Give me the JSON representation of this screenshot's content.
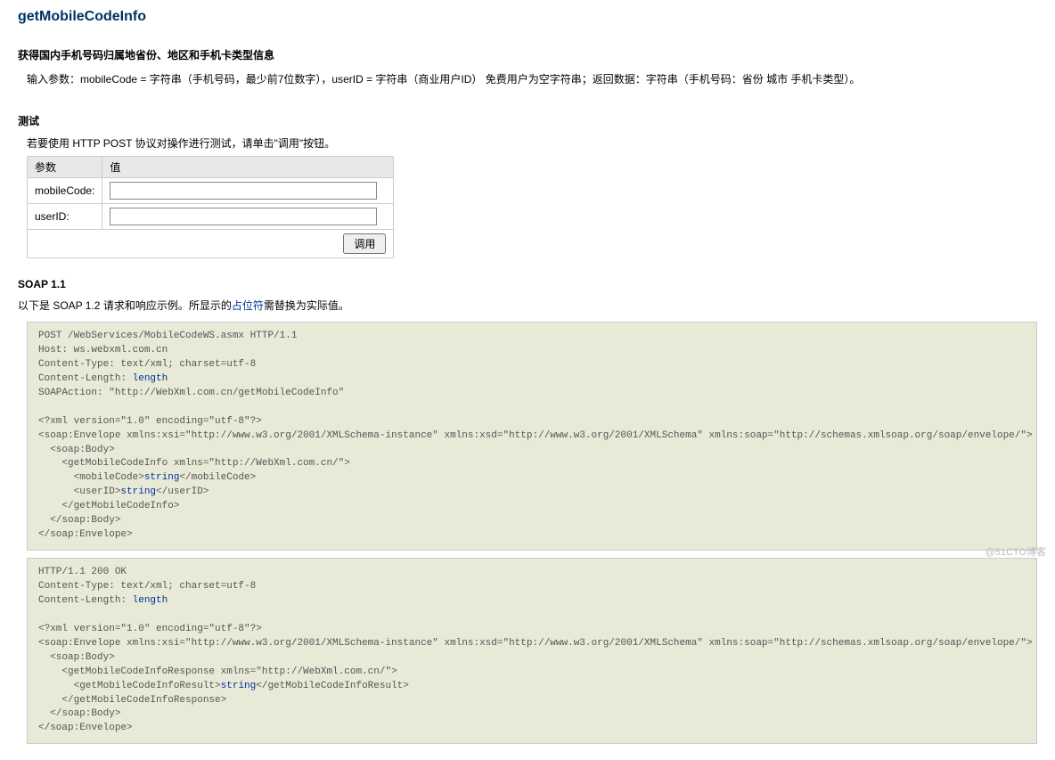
{
  "page": {
    "title": "getMobileCodeInfo",
    "subtitle": "获得国内手机号码归属地省份、地区和手机卡类型信息",
    "param_desc": "输入参数：mobileCode = 字符串（手机号码，最少前7位数字），userID = 字符串（商业用户ID） 免费用户为空字符串；返回数据：字符串（手机号码：省份 城市 手机卡类型）。"
  },
  "test": {
    "heading": "测试",
    "instruction": "若要使用 HTTP POST 协议对操作进行测试，请单击\"调用\"按钮。",
    "col_param": "参数",
    "col_value": "值",
    "rows": [
      {
        "label": "mobileCode:"
      },
      {
        "label": "userID:"
      }
    ],
    "invoke_label": "调用"
  },
  "soap": {
    "heading": "SOAP 1.1",
    "desc_prefix": "以下是 SOAP 1.2 请求和响应示例。所显示的",
    "placeholder_word": "占位符",
    "desc_suffix": "需替换为实际值。",
    "request": {
      "l1": "POST /WebServices/MobileCodeWS.asmx HTTP/1.1",
      "l2": "Host: ws.webxml.com.cn",
      "l3": "Content-Type: text/xml; charset=utf-8",
      "l4a": "Content-Length: ",
      "l4b": "length",
      "l5": "SOAPAction: \"http://WebXml.com.cn/getMobileCodeInfo\"",
      "l6": "<?xml version=\"1.0\" encoding=\"utf-8\"?>",
      "l7": "<soap:Envelope xmlns:xsi=\"http://www.w3.org/2001/XMLSchema-instance\" xmlns:xsd=\"http://www.w3.org/2001/XMLSchema\" xmlns:soap=\"http://schemas.xmlsoap.org/soap/envelope/\">",
      "l8": "  <soap:Body>",
      "l9": "    <getMobileCodeInfo xmlns=\"http://WebXml.com.cn/\">",
      "l10a": "      <mobileCode>",
      "l10b": "string",
      "l10c": "</mobileCode>",
      "l11a": "      <userID>",
      "l11b": "string",
      "l11c": "</userID>",
      "l12": "    </getMobileCodeInfo>",
      "l13": "  </soap:Body>",
      "l14": "</soap:Envelope>"
    },
    "response": {
      "l1": "HTTP/1.1 200 OK",
      "l2": "Content-Type: text/xml; charset=utf-8",
      "l3a": "Content-Length: ",
      "l3b": "length",
      "l4": "<?xml version=\"1.0\" encoding=\"utf-8\"?>",
      "l5": "<soap:Envelope xmlns:xsi=\"http://www.w3.org/2001/XMLSchema-instance\" xmlns:xsd=\"http://www.w3.org/2001/XMLSchema\" xmlns:soap=\"http://schemas.xmlsoap.org/soap/envelope/\">",
      "l6": "  <soap:Body>",
      "l7": "    <getMobileCodeInfoResponse xmlns=\"http://WebXml.com.cn/\">",
      "l8a": "      <getMobileCodeInfoResult>",
      "l8b": "string",
      "l8c": "</getMobileCodeInfoResult>",
      "l9": "    </getMobileCodeInfoResponse>",
      "l10": "  </soap:Body>",
      "l11": "</soap:Envelope>"
    }
  },
  "watermark": "@51CTO博客"
}
